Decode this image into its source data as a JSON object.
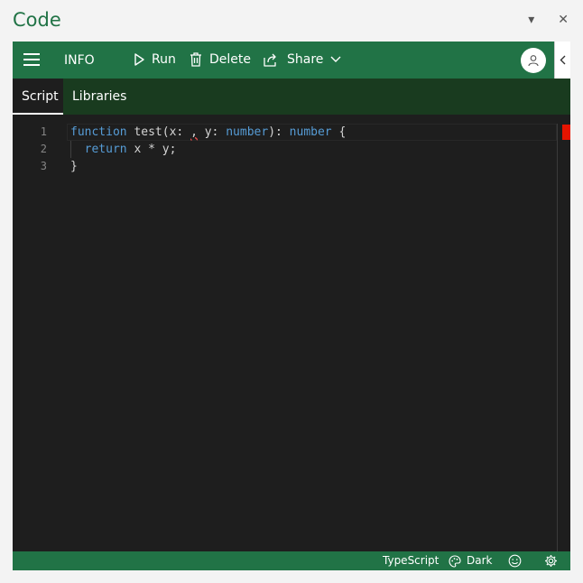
{
  "pane": {
    "title": "Code",
    "dropdown_glyph": "▾",
    "close_glyph": "✕"
  },
  "toolbar": {
    "info_label": "INFO",
    "run_label": "Run",
    "delete_label": "Delete",
    "share_label": "Share"
  },
  "tabs": [
    {
      "label": "Script",
      "active": true
    },
    {
      "label": "Libraries",
      "active": false
    }
  ],
  "editor": {
    "line_numbers": [
      "1",
      "2",
      "3"
    ],
    "lines": [
      [
        "function",
        " test(x: ",
        ",",
        " y: ",
        "number",
        "): ",
        "number",
        " {"
      ],
      [
        "  ",
        "return",
        " x * y;"
      ],
      [
        "}"
      ]
    ]
  },
  "statusbar": {
    "language": "TypeScript",
    "theme": "Dark"
  },
  "icons": {
    "menu": "hamburger-icon",
    "run": "play-icon",
    "delete": "trash-icon",
    "share": "share-icon",
    "share_dropdown": "chevron-down-icon",
    "avatar": "user-icon",
    "collapse": "chevron-left-icon",
    "theme": "palette-icon",
    "feedback": "smiley-icon",
    "settings": "gear-icon"
  },
  "colors": {
    "brand_green": "#217346",
    "tab_bar": "#193b1f",
    "editor_bg": "#1e1e1e",
    "keyword": "#569cd6",
    "error": "#e51400"
  }
}
